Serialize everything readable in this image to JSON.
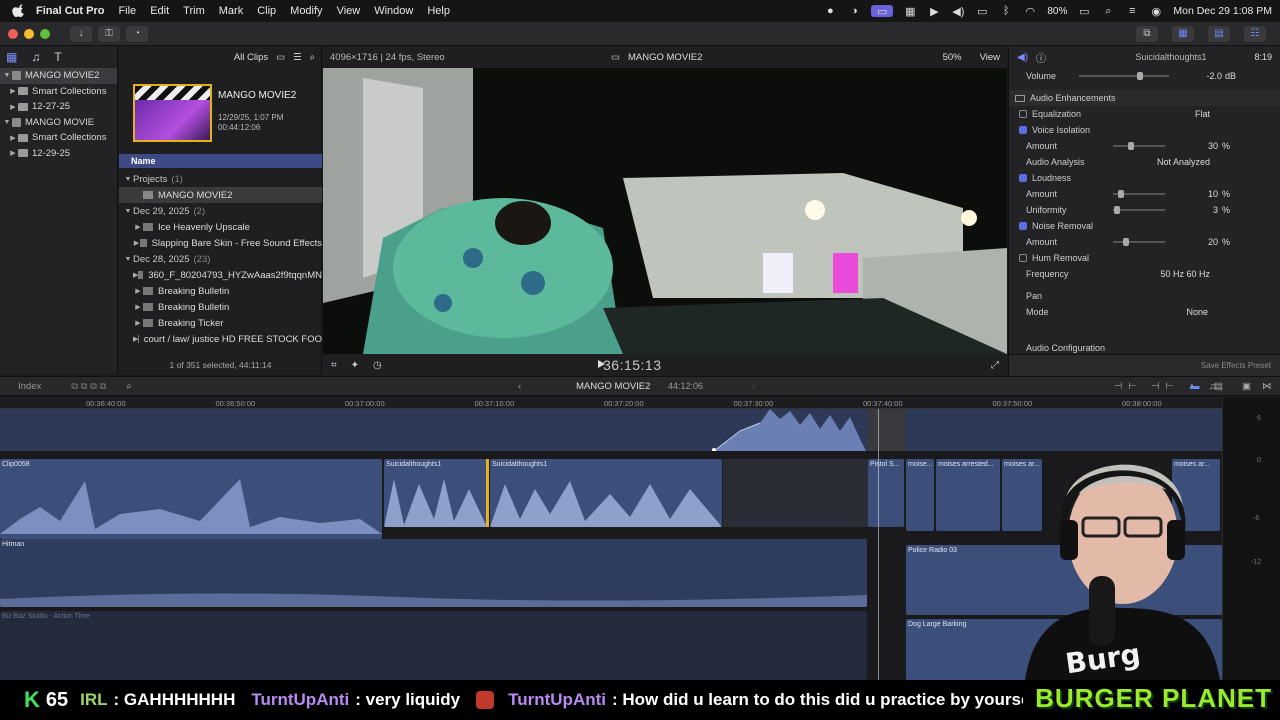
{
  "menubar": {
    "app": "Final Cut Pro",
    "items": [
      "File",
      "Edit",
      "Trim",
      "Mark",
      "Clip",
      "Modify",
      "View",
      "Window",
      "Help"
    ],
    "battery": "80%",
    "clock": "Mon Dec 29  1:08 PM"
  },
  "libraries": {
    "items": [
      {
        "label": "MANGO MOVIE2",
        "level": 0,
        "selected": true
      },
      {
        "label": "Smart Collections",
        "level": 1
      },
      {
        "label": "12-27-25",
        "level": 1
      },
      {
        "label": "MANGO MOVIE",
        "level": 0
      },
      {
        "label": "Smart Collections",
        "level": 1
      },
      {
        "label": "12-29-25",
        "level": 1
      }
    ]
  },
  "browser": {
    "filter": "All Clips",
    "project_title": "MANGO MOVIE2",
    "project_date": "12/29/25, 1:07 PM",
    "project_duration": "00:44:12:06",
    "column_name": "Name",
    "rows": [
      {
        "label": "Projects",
        "count": "(1)",
        "group": true
      },
      {
        "label": "MANGO MOVIE2",
        "selected": true
      },
      {
        "label": "Dec 29, 2025",
        "count": "(2)",
        "group": true
      },
      {
        "label": "Ice Heavenly Upscale"
      },
      {
        "label": "Slapping Bare Skin - Free Sound Effects"
      },
      {
        "label": "Dec 28, 2025",
        "count": "(23)",
        "group": true
      },
      {
        "label": "360_F_80204793_HYZwAaas2f9tqqnMN"
      },
      {
        "label": "Breaking Bulletin"
      },
      {
        "label": "Breaking Bulletin"
      },
      {
        "label": "Breaking Ticker"
      },
      {
        "label": "court / law/ justice HD FREE STOCK FOO"
      }
    ],
    "footer": "1 of 351 selected, 44:11:14"
  },
  "viewer": {
    "format": "4096×1716 | 24 fps, Stereo",
    "title": "MANGO MOVIE2",
    "zoom": "50%",
    "view_label": "View",
    "timecode": "36:15:13"
  },
  "inspector": {
    "clip_name": "Suicidalthoughts1",
    "duration": "8:19",
    "volume_label": "Volume",
    "volume_value": "-2.0",
    "volume_unit": "dB",
    "enhancements_label": "Audio Enhancements",
    "rows": [
      {
        "label": "Equalization",
        "check": false,
        "value": "Flat"
      },
      {
        "label": "Voice Isolation",
        "check": true
      },
      {
        "label": "Amount",
        "value": "30",
        "unit": "%",
        "slider": 0.32
      },
      {
        "label": "Audio Analysis",
        "value": "Not Analyzed"
      },
      {
        "label": "Loudness",
        "check": true
      },
      {
        "label": "Amount",
        "value": "10",
        "unit": "%",
        "slider": 0.1
      },
      {
        "label": "Uniformity",
        "value": "3",
        "unit": "%",
        "slider": 0.03
      },
      {
        "label": "Noise Removal",
        "check": true
      },
      {
        "label": "Amount",
        "value": "20",
        "unit": "%",
        "slider": 0.22
      },
      {
        "label": "Hum Removal",
        "check": false
      },
      {
        "label": "Frequency",
        "value": "50 Hz     60 Hz"
      }
    ],
    "pan_label": "Pan",
    "mode_label": "Mode",
    "mode_value": "None",
    "config_label": "Audio Configuration",
    "save_preset": "Save Effects Preset"
  },
  "timeline": {
    "index_label": "Index",
    "title": "MANGO MOVIE2",
    "duration": "44:12:06",
    "ruler": [
      "00:36:40:00",
      "00:36:50:00",
      "00:37:00:00",
      "00:37:10:00",
      "00:37:20:00",
      "00:37:30:00",
      "00:37:40:00",
      "00:37:50:00",
      "00:38:00:00"
    ],
    "clips": {
      "clip0058": "Clip0058",
      "suicidal1": "Suicidalthoughts1",
      "suicidal2": "Suicidalthoughts1",
      "pistol": "Pistol S...",
      "moises1": "moise...",
      "moises2": "moises arrested...",
      "moises3": "moises ar...",
      "moises4": "moises ar...",
      "hitman": "Hitman",
      "police": "Police Radio 03",
      "dog": "Dog Large Barking",
      "action": "Biz Baz Studio - Action Time"
    },
    "meter_labels": [
      "6",
      "0",
      "-6",
      "-12"
    ]
  },
  "chat": {
    "kick_count": "65",
    "messages": [
      {
        "user": "IRL",
        "text": ": GAHHHHHHH",
        "green": true
      },
      {
        "user": "TurntUpAnti",
        "text": ": very liquidy"
      },
      {
        "user": "TurntUpAnti",
        "text": ": How did u learn to do this did u practice by yourself"
      }
    ],
    "burger": "BURGER PLANET"
  }
}
